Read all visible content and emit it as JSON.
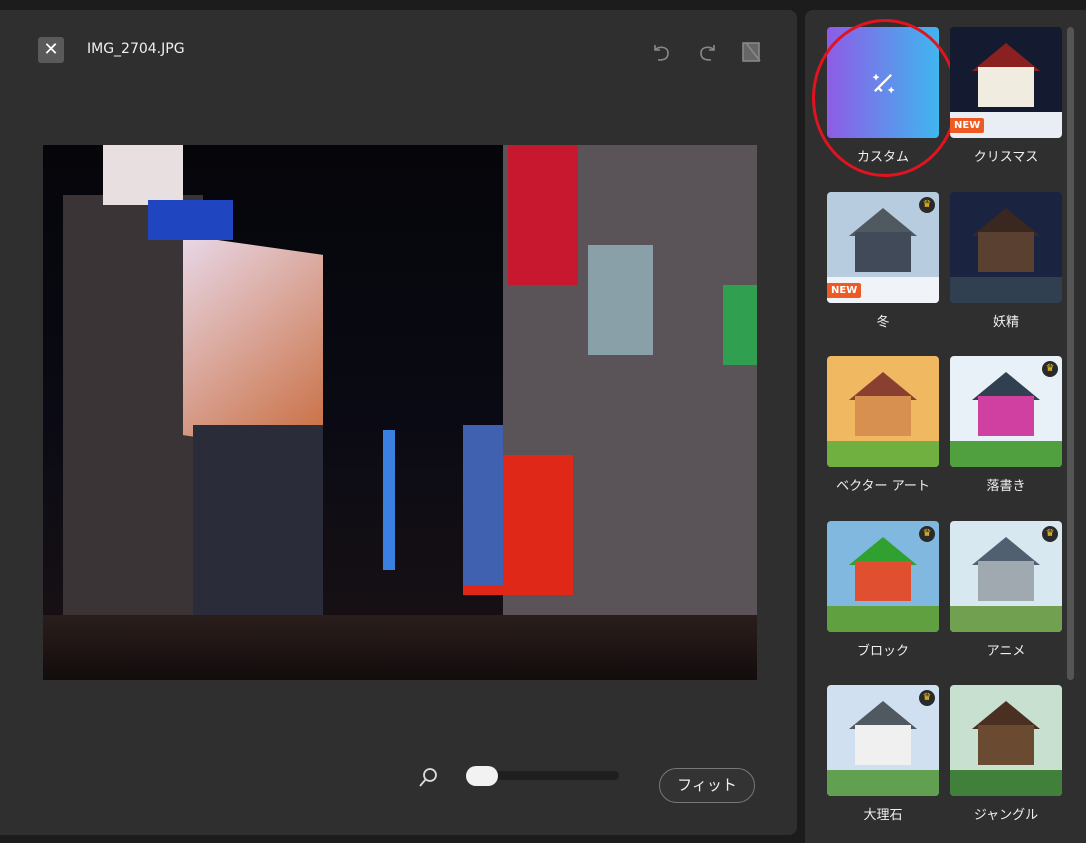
{
  "header": {
    "filename": "IMG_2704.JPG",
    "close_icon": "close-icon",
    "undo_icon": "undo-icon",
    "redo_icon": "redo-icon",
    "compare_icon": "compare-icon"
  },
  "zoom": {
    "icon": "search-icon",
    "level_percent": 0,
    "fit_label": "フィット"
  },
  "styles": [
    {
      "label": "カスタム",
      "badge": "",
      "premium": false,
      "selected": true
    },
    {
      "label": "クリスマス",
      "badge": "NEW",
      "premium": false
    },
    {
      "label": "冬",
      "badge": "NEW",
      "premium": true
    },
    {
      "label": "妖精",
      "badge": "",
      "premium": false
    },
    {
      "label": "ベクター アート",
      "badge": "",
      "premium": false
    },
    {
      "label": "落書き",
      "badge": "",
      "premium": true
    },
    {
      "label": "ブロック",
      "badge": "",
      "premium": true
    },
    {
      "label": "アニメ",
      "badge": "",
      "premium": true
    },
    {
      "label": "大理石",
      "badge": "",
      "premium": true
    },
    {
      "label": "ジャングル",
      "badge": "",
      "premium": false
    }
  ],
  "colors": {
    "custom_gradient_start": "#8e5ce6",
    "custom_gradient_end": "#3fb6ef",
    "new_badge": "#ee5a24",
    "highlight_ring": "#e0141e"
  }
}
